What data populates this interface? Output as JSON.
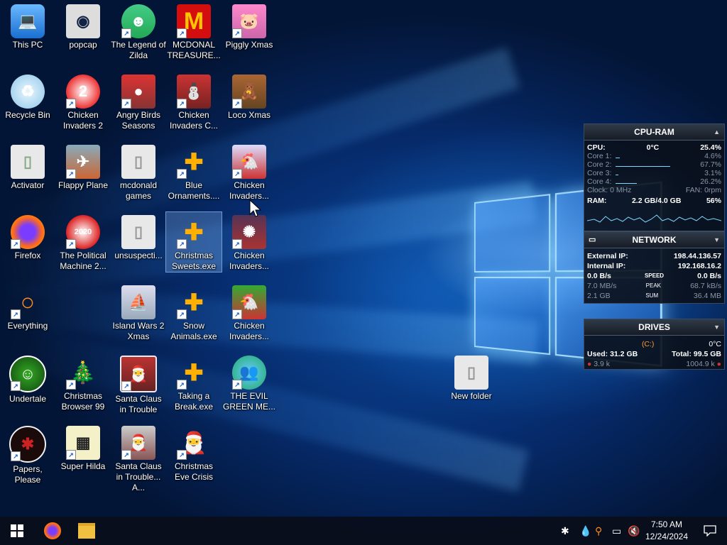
{
  "desktop_icons": [
    {
      "label": "This PC"
    },
    {
      "label": "popcap"
    },
    {
      "label": "The Legend of Zilda"
    },
    {
      "label": "MCDONAL TREASURE..."
    },
    {
      "label": "Piggly Xmas"
    },
    {
      "label": "Recycle Bin"
    },
    {
      "label": "Chicken Invaders 2"
    },
    {
      "label": "Angry Birds Seasons"
    },
    {
      "label": "Chicken Invaders C..."
    },
    {
      "label": "Loco Xmas"
    },
    {
      "label": "Activator"
    },
    {
      "label": "Flappy Plane"
    },
    {
      "label": "mcdonald games"
    },
    {
      "label": "Blue Ornaments...."
    },
    {
      "label": "Chicken Invaders..."
    },
    {
      "label": "Firefox"
    },
    {
      "label": "The Political Machine 2..."
    },
    {
      "label": "unsuspecti..."
    },
    {
      "label": "Christmas Sweets.exe"
    },
    {
      "label": "Chicken Invaders..."
    },
    {
      "label": "Everything"
    },
    {
      "label": "Island Wars 2 Xmas"
    },
    {
      "label": "Snow Animals.exe"
    },
    {
      "label": "Chicken Invaders..."
    },
    {
      "label": "Undertale"
    },
    {
      "label": "Christmas Browser 99"
    },
    {
      "label": "Santa Claus in Trouble"
    },
    {
      "label": "Taking a Break.exe"
    },
    {
      "label": "THE EVIL GREEN ME..."
    },
    {
      "label": "Papers, Please"
    },
    {
      "label": "Super Hilda"
    },
    {
      "label": "Santa Claus in Trouble... A..."
    },
    {
      "label": "Christmas Eve Crisis"
    },
    {
      "label": "New folder"
    }
  ],
  "cpu_ram": {
    "title": "CPU-RAM",
    "cpu_label": "CPU:",
    "cpu_temp": "0°C",
    "cpu_pct": "25.4%",
    "cores": [
      {
        "label": "Core 1:",
        "value": "4.6%",
        "pct": 4.6
      },
      {
        "label": "Core 2:",
        "value": "67.7%",
        "pct": 67.7
      },
      {
        "label": "Core 3:",
        "value": "3.1%",
        "pct": 3.1
      },
      {
        "label": "Core 4:",
        "value": "26.2%",
        "pct": 26.2
      }
    ],
    "clock": "Clock: 0 MHz",
    "fan": "FAN: 0rpm",
    "ram_label": "RAM:",
    "ram_used": "2.2 GB/4.0 GB",
    "ram_pct": "56%"
  },
  "network": {
    "title": "NETWORK",
    "external_label": "External IP:",
    "external_ip": "198.44.136.57",
    "internal_label": "Internal IP:",
    "internal_ip": "192.168.16.2",
    "row1_left": "0.0 B/s",
    "row1_mid": "SPEED",
    "row1_right": "0.0 B/s",
    "row2_left": "7.0 MB/s",
    "row2_mid": "PEAK",
    "row2_right": "68.7 kB/s",
    "row3_left": "2.1 GB",
    "row3_mid": "SUM",
    "row3_right": "36.4 MB"
  },
  "drives": {
    "title": "DRIVES",
    "drive": "(C:)",
    "temp": "0°C",
    "used": "Used: 31.2 GB",
    "total": "Total: 99.5 GB",
    "read": "3.9 k",
    "write": "1004.9 k"
  },
  "taskbar": {
    "time": "7:50 AM",
    "date": "12/24/2024"
  },
  "colors": {
    "accent": "#7fd6ff",
    "taskbar": "#080e1a",
    "ram_graph": "#7fd6ff"
  }
}
